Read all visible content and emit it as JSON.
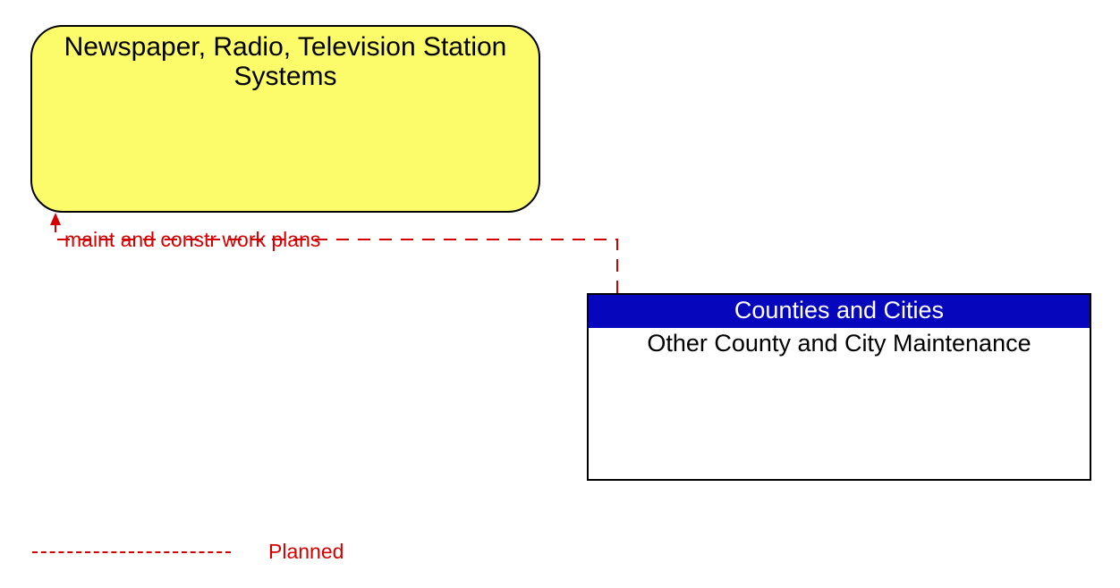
{
  "nodes": {
    "media": {
      "title_line1": "Newspaper, Radio, Television Station",
      "title_line2": "Systems"
    },
    "county": {
      "header": "Counties and Cities",
      "subtitle": "Other County and City Maintenance"
    }
  },
  "flow": {
    "label": "maint and constr work plans"
  },
  "legend": {
    "planned": "Planned"
  },
  "colors": {
    "planned_line": "#d40000",
    "media_fill": "#fcfc6a",
    "county_header_bg": "#0606bd"
  }
}
